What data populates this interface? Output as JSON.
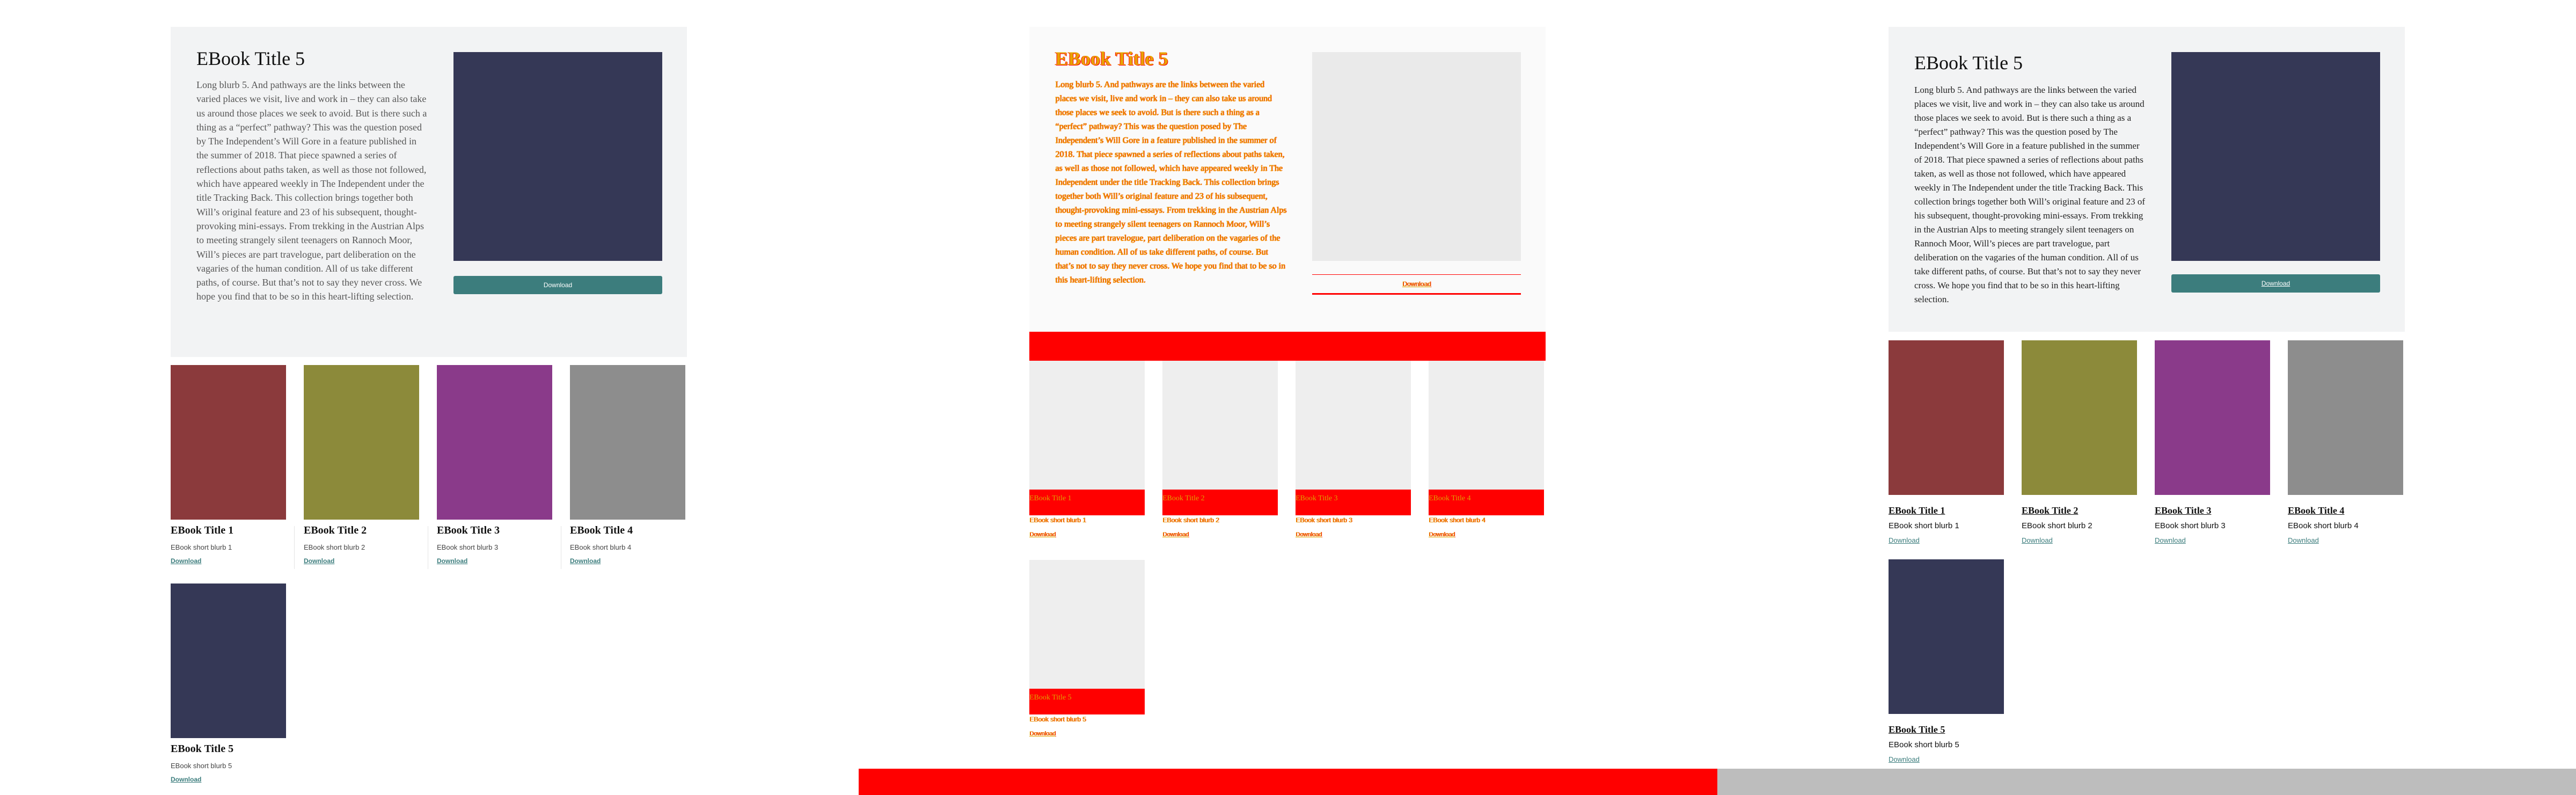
{
  "featured": {
    "title": "EBook Title 5",
    "blurb": "Long blurb 5. And pathways are the links between the varied places we visit, live and work in – they can also take us around those places we seek to avoid. But is there such a thing as a “perfect” pathway? This was the question posed by The Independent’s Will Gore in a feature published in the summer of 2018. That piece spawned a series of reflections about paths taken, as well as those not followed, which have appeared weekly in The Independent under the title Tracking Back. This collection brings together both Will’s original feature and 23 of his subsequent, thought-provoking mini-essays. From trekking in the Austrian Alps to meeting strangely silent teenagers on Rannoch Moor, Will’s pieces are part travelogue, part deliberation on the vagaries of the human condition. All of us take different paths, of course. But that’s not to say they never cross. We hope you find that to be so in this heart-lifting selection.",
    "download_label": "Download",
    "cover_color": "#353856"
  },
  "books": [
    {
      "title": "EBook Title 1",
      "blurb": "EBook short blurb 1",
      "download_label": "Download",
      "cover_color": "#8b3a3c"
    },
    {
      "title": "EBook Title 2",
      "blurb": "EBook short blurb 2",
      "download_label": "Download",
      "cover_color": "#8c8a3a"
    },
    {
      "title": "EBook Title 3",
      "blurb": "EBook short blurb 3",
      "download_label": "Download",
      "cover_color": "#8a3a8a"
    },
    {
      "title": "EBook Title 4",
      "blurb": "EBook short blurb 4",
      "download_label": "Download",
      "cover_color": "#8d8d8d"
    },
    {
      "title": "EBook Title 5",
      "blurb": "EBook short blurb 5",
      "download_label": "Download",
      "cover_color": "#353856"
    }
  ],
  "colors": {
    "accent": "#3c7d7d",
    "card_background": "#f2f3f4",
    "highlight_red": "#ff0000",
    "highlight_orange": "#e0a000",
    "status_grey": "#bdbdbd"
  }
}
